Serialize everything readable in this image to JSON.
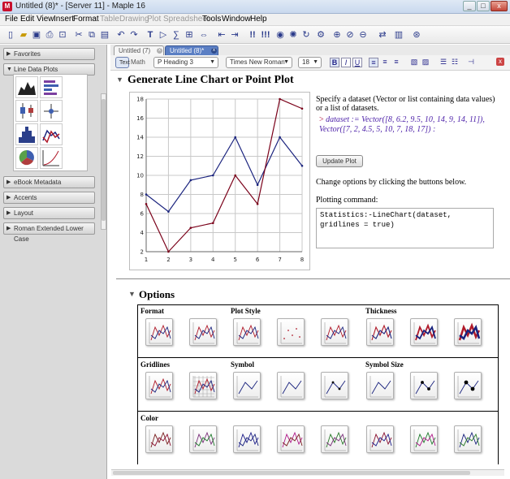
{
  "window": {
    "title": "Untitled (8)* - [Server 11] - Maple 16"
  },
  "menu": {
    "items": [
      "File",
      "Edit",
      "View",
      "Insert",
      "Format",
      "Table",
      "Drawing",
      "Plot",
      "Spreadsheet",
      "Tools",
      "Window",
      "Help"
    ],
    "disabled": [
      "Table",
      "Drawing",
      "Plot",
      "Spreadsheet"
    ]
  },
  "palettes": {
    "top": [
      {
        "label": "Favorites",
        "expanded": false
      },
      {
        "label": "Line Data Plots",
        "expanded": true
      }
    ],
    "bottom": [
      {
        "label": "eBook Metadata",
        "expanded": false
      },
      {
        "label": "Accents",
        "expanded": false
      },
      {
        "label": "Layout",
        "expanded": false
      },
      {
        "label": "Roman Extended Lower Case",
        "expanded": false
      }
    ]
  },
  "tabs": [
    {
      "label": "Untitled (7)",
      "active": false
    },
    {
      "label": "Untitled (8)*",
      "active": true
    }
  ],
  "context_bar": {
    "mode_text": "Text",
    "mode_math": "Math",
    "style": "P Heading 3",
    "font": "Times New Roman",
    "size": "18",
    "bold": "B",
    "italic": "I",
    "underline": "U"
  },
  "section1": {
    "title": "Generate Line Chart or Point Plot",
    "description": "Specify a dataset (Vector or list containing data values) or a list of datasets.",
    "assignment": "dataset := Vector([8, 6.2, 9.5, 10, 14, 9, 14, 11]), Vector([7, 2, 4.5, 5, 10, 7, 18, 17]) :",
    "update_button": "Update Plot",
    "options_hint": "Change options by clicking the buttons below.",
    "plotting_label": "Plotting command:",
    "command": "Statistics:-LineChart(dataset, gridlines = true)"
  },
  "chart_data": {
    "type": "line",
    "x": [
      1,
      2,
      3,
      4,
      5,
      6,
      7,
      8
    ],
    "series": [
      {
        "values": [
          8,
          6.2,
          9.5,
          10,
          14,
          9,
          14,
          11
        ],
        "color": "#1a237e"
      },
      {
        "values": [
          7,
          2,
          4.5,
          5,
          10,
          7,
          18,
          17
        ],
        "color": "#7a0019"
      }
    ],
    "xlim": [
      1,
      8
    ],
    "ylim": [
      2,
      18
    ],
    "xticks": [
      1,
      2,
      3,
      4,
      5,
      6,
      7,
      8
    ],
    "yticks": [
      2,
      4,
      6,
      8,
      10,
      12,
      14,
      16,
      18
    ],
    "grid": true,
    "title": "",
    "xlabel": "",
    "ylabel": ""
  },
  "section2": {
    "title": "Options",
    "headers": {
      "format": "Format",
      "plot_style": "Plot Style",
      "thickness": "Thickness",
      "gridlines": "Gridlines",
      "symbol": "Symbol",
      "symbol_size": "Symbol Size",
      "color": "Color"
    },
    "color_swatches": [
      "#8a1030",
      "#1f7a2c",
      "#1a237e",
      "#7a1f1f",
      "#7a2f7a",
      "#1f1f8a",
      "#b01a8a",
      "#2a7a2a"
    ]
  },
  "colors": {
    "series_blue": "#1a237e",
    "series_red": "#7a0019",
    "heading_triangle": "#555555"
  }
}
